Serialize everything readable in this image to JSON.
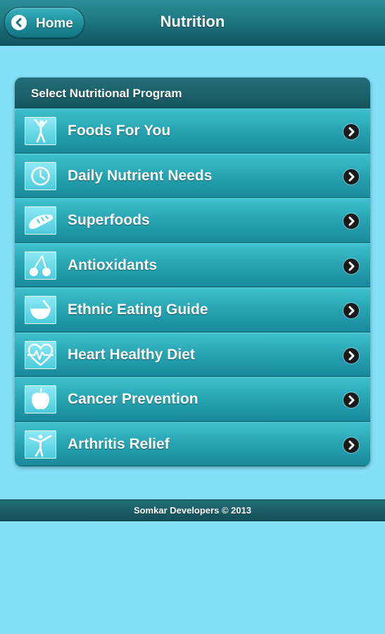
{
  "header": {
    "back_label": "Home",
    "title": "Nutrition"
  },
  "panel": {
    "heading": "Select Nutritional Program",
    "items": [
      {
        "label": "Foods For You",
        "icon": "person-stretch-icon"
      },
      {
        "label": "Daily Nutrient Needs",
        "icon": "clock-icon"
      },
      {
        "label": "Superfoods",
        "icon": "bread-icon"
      },
      {
        "label": "Antioxidants",
        "icon": "cherries-icon"
      },
      {
        "label": "Ethnic Eating Guide",
        "icon": "bowl-spoon-icon"
      },
      {
        "label": "Heart Healthy Diet",
        "icon": "heartbeat-icon"
      },
      {
        "label": "Cancer Prevention",
        "icon": "apple-icon"
      },
      {
        "label": "Arthritis Relief",
        "icon": "person-balance-icon"
      }
    ]
  },
  "footer": {
    "text": "Somkar Developers © 2013"
  },
  "colors": {
    "background": "#84e0f7",
    "header": "#1d747f",
    "item": "#26a3b1"
  }
}
